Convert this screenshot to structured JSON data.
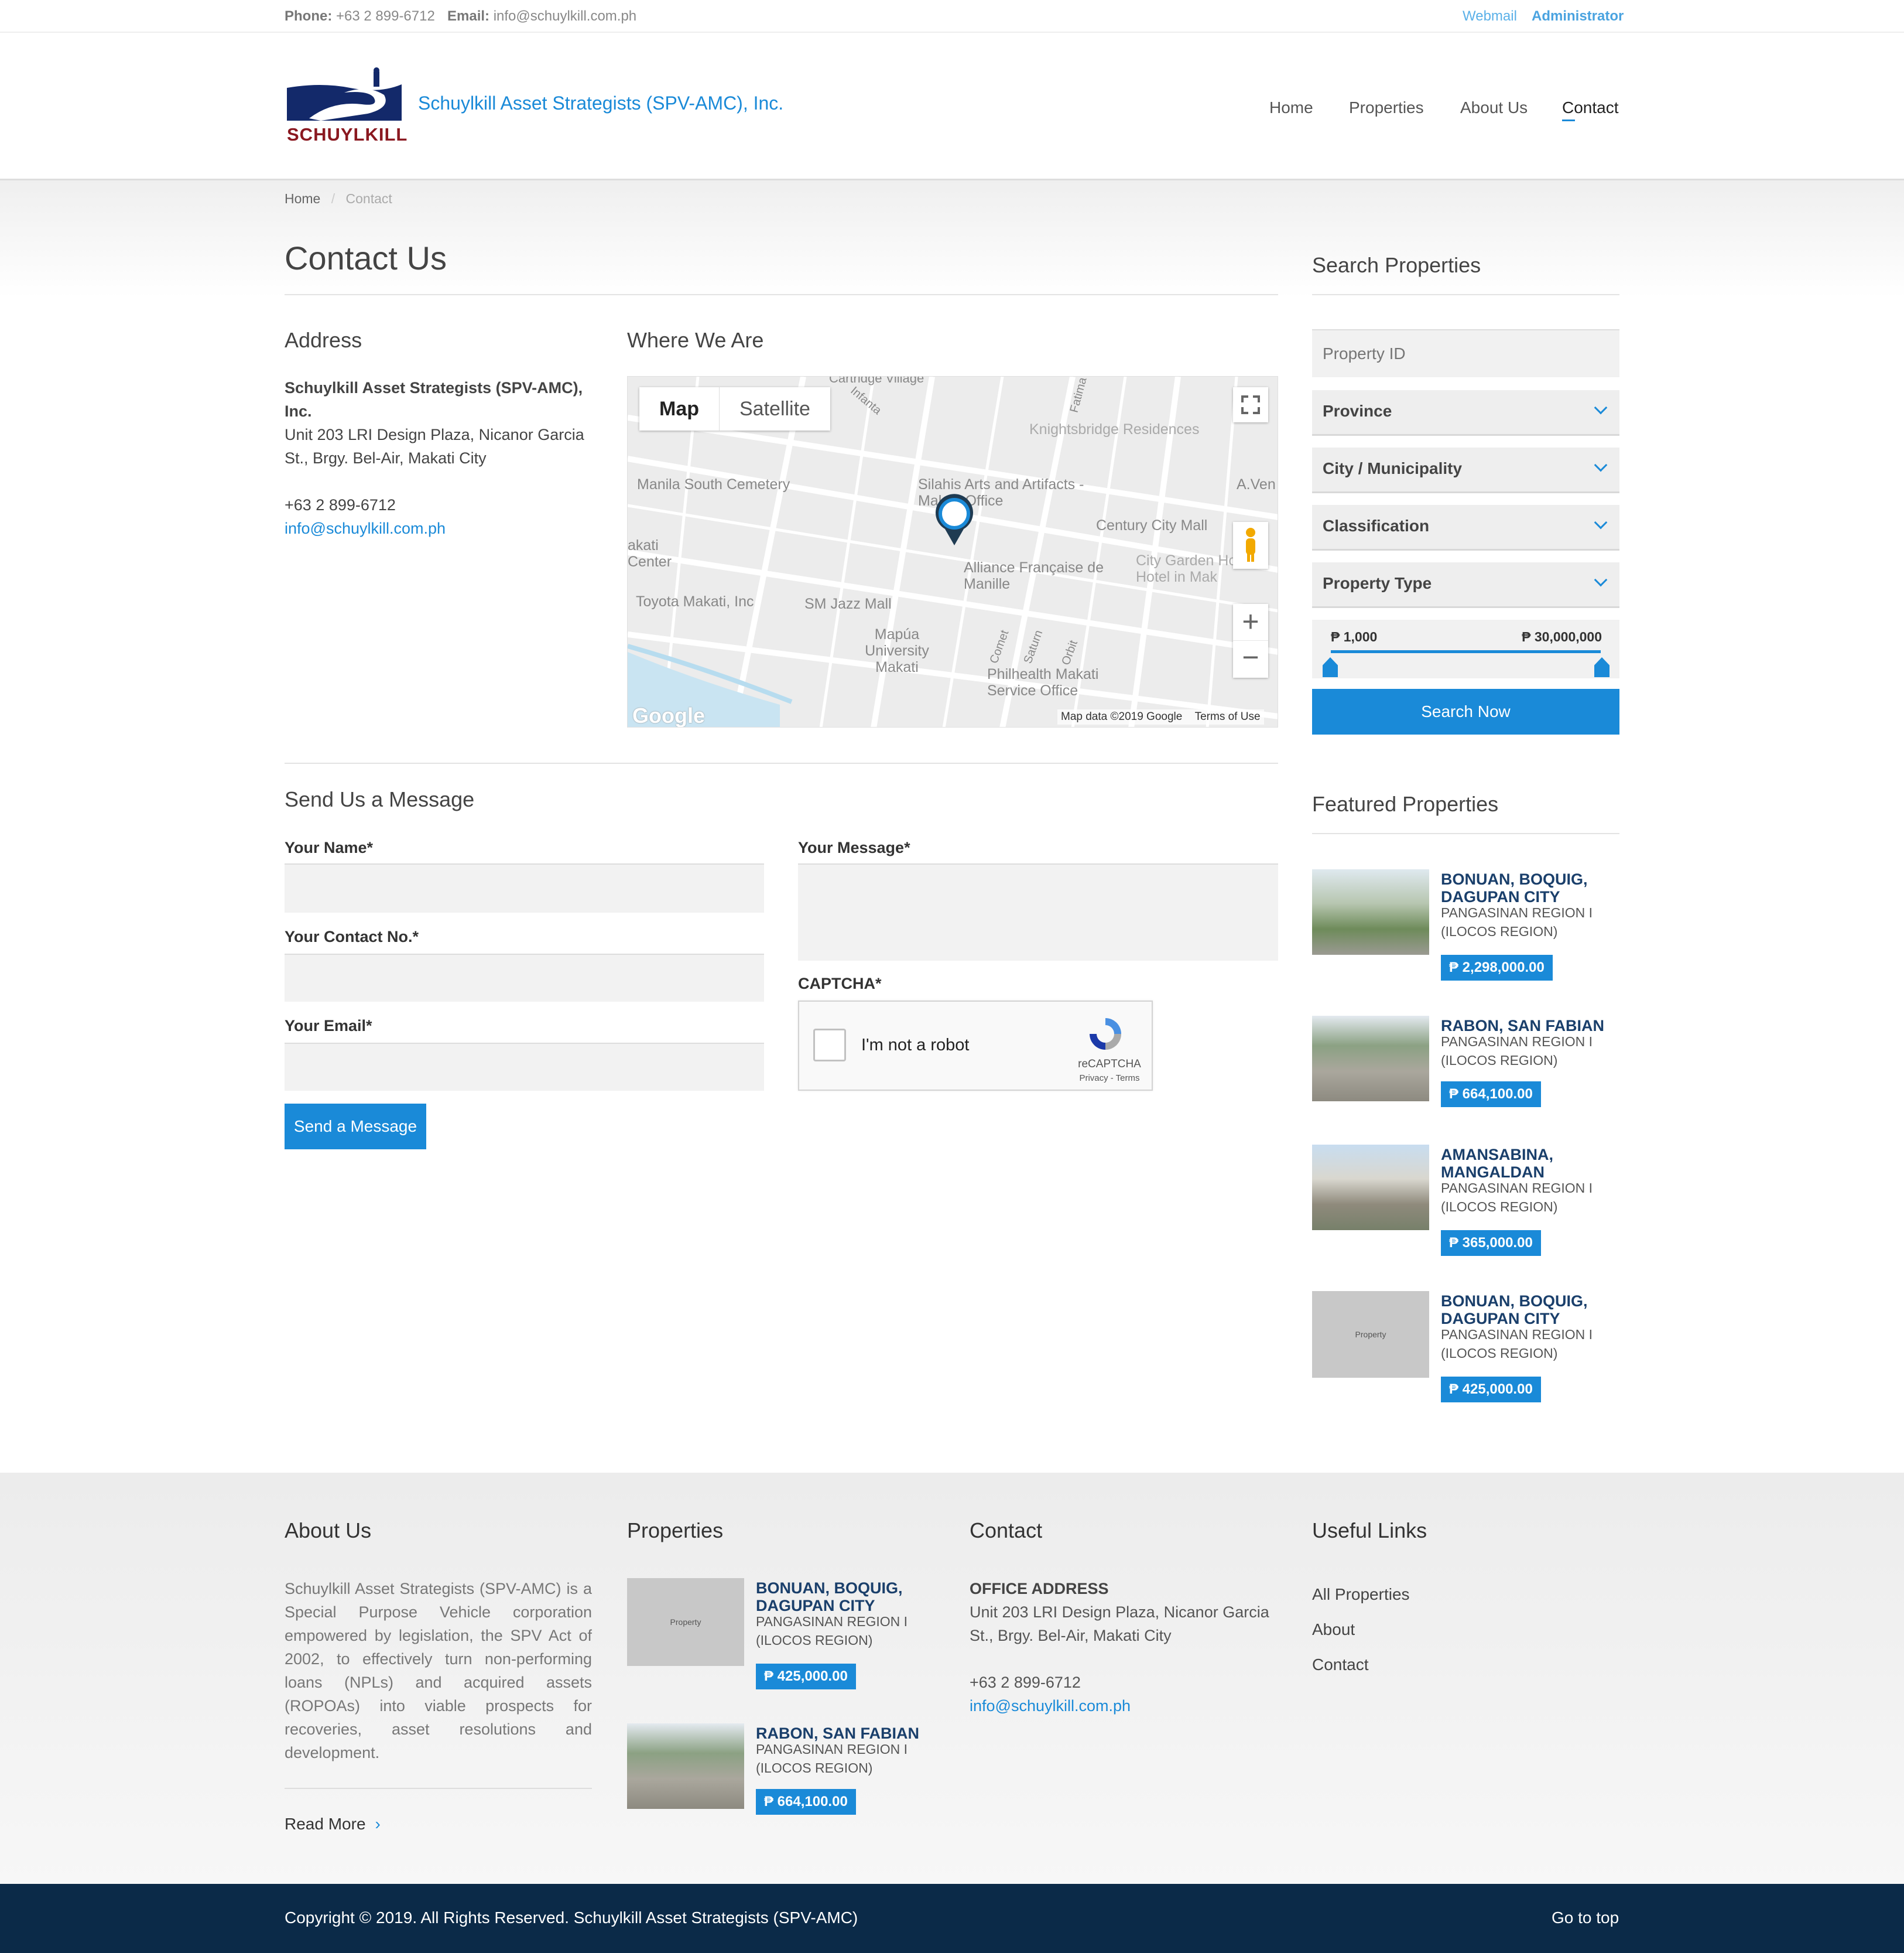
{
  "topbar": {
    "phone_label": "Phone:",
    "phone": "+63 2 899-6712",
    "email_label": "Email:",
    "email": "info@schuylkill.com.ph",
    "webmail": "Webmail",
    "admin": "Administrator"
  },
  "header": {
    "logo_text": "SCHUYLKILL",
    "company": "Schuylkill Asset Strategists (SPV-AMC), Inc.",
    "nav": [
      "Home",
      "Properties",
      "About Us",
      "Contact"
    ]
  },
  "breadcrumb": {
    "home": "Home",
    "sep": "/",
    "current": "Contact"
  },
  "page_title": "Contact Us",
  "address": {
    "heading": "Address",
    "company": "Schuylkill Asset Strategists (SPV-AMC), Inc.",
    "line1": "Unit 203 LRI Design Plaza, Nicanor Garcia",
    "line2": "St., Brgy. Bel-Air, Makati City",
    "phone": "+63 2 899-6712",
    "email": "info@schuylkill.com.ph"
  },
  "map": {
    "heading": "Where We Are",
    "tab_map": "Map",
    "tab_satellite": "Satellite",
    "labels": [
      "Manila South Cemetery",
      "Silahis Arts and Artifacts - Makati Office",
      "Knightsbridge Residences",
      "Century City Mall",
      "Alliance Française de Manille",
      "Toyota Makati, Inc",
      "SM Jazz Mall",
      "Mapúa University Makati",
      "Philhealth Makati Service Office",
      "akati Center",
      "City Garden Hotel - Hotel in Mak",
      "A.Ven",
      "Cartridge Village",
      "Comet",
      "Saturn",
      "Orbit",
      "Infanta",
      "Fatima"
    ],
    "attribution": "Map data ©2019 Google",
    "terms": "Terms of Use",
    "google": "Google"
  },
  "form": {
    "heading": "Send Us a Message",
    "name_label": "Your Name",
    "contact_label": "Your Contact No.",
    "email_label": "Your Email",
    "message_label": "Your Message",
    "captcha_label": "CAPTCHA",
    "required_mark": "*",
    "captcha_text": "I'm not a robot",
    "recaptcha": "reCAPTCHA",
    "recaptcha_links": "Privacy - Terms",
    "submit": "Send a Message"
  },
  "search": {
    "heading": "Search Properties",
    "property_id_placeholder": "Property ID",
    "province": "Province",
    "city": "City / Municipality",
    "classification": "Classification",
    "property_type": "Property Type",
    "min_price": "₱ 1,000",
    "max_price": "₱ 30,000,000",
    "button": "Search Now"
  },
  "featured": {
    "heading": "Featured Properties",
    "items": [
      {
        "title": "BONUAN, BOQUIG, DAGUPAN CITY",
        "sub1": "PANGASINAN REGION I",
        "sub2": "(ILOCOS REGION)",
        "price": "₱ 2,298,000.00",
        "thumb": ""
      },
      {
        "title": "RABON, SAN FABIAN",
        "sub1": "PANGASINAN REGION I",
        "sub2": "(ILOCOS REGION)",
        "price": "₱ 664,100.00",
        "thumb": ""
      },
      {
        "title": "AMANSABINA, MANGALDAN",
        "sub1": "PANGASINAN REGION I",
        "sub2": "(ILOCOS REGION)",
        "price": "₱ 365,000.00",
        "thumb": ""
      },
      {
        "title": "BONUAN, BOQUIG, DAGUPAN CITY",
        "sub1": "PANGASINAN REGION I",
        "sub2": "(ILOCOS REGION)",
        "price": "₱ 425,000.00",
        "thumb": "Property"
      }
    ]
  },
  "footer": {
    "about_heading": "About Us",
    "about_text": "Schuylkill Asset Strategists (SPV-AMC) is a Special Purpose Vehicle corporation empowered by legislation, the SPV Act of 2002, to effectively turn non-performing loans (NPLs) and acquired assets (ROPOAs) into viable prospects for recoveries, asset resolutions and development.",
    "read_more": "Read More",
    "properties_heading": "Properties",
    "properties": [
      {
        "title": "BONUAN, BOQUIG, DAGUPAN CITY",
        "sub1": "PANGASINAN REGION I",
        "sub2": "(ILOCOS REGION)",
        "price": "₱ 425,000.00",
        "thumb": "Property"
      },
      {
        "title": "RABON, SAN FABIAN",
        "sub1": "PANGASINAN REGION I",
        "sub2": "(ILOCOS REGION)",
        "price": "₱ 664,100.00",
        "thumb": ""
      }
    ],
    "contact_heading": "Contact",
    "office_label": "OFFICE ADDRESS",
    "office_line1": "Unit 203 LRI Design Plaza, Nicanor Garcia",
    "office_line2": "St., Brgy. Bel-Air, Makati City",
    "phone": "+63 2 899-6712",
    "email": "info@schuylkill.com.ph",
    "links_heading": "Useful Links",
    "links": [
      "All Properties",
      "About",
      "Contact"
    ]
  },
  "bottom": {
    "copyright": "Copyright © 2019. All Rights Reserved. Schuylkill Asset Strategists (SPV-AMC)",
    "go_top": "Go to top"
  },
  "colors": {
    "accent": "#1a8ad8",
    "navy": "#0b2a48",
    "title_blue": "#1a3f6b"
  }
}
